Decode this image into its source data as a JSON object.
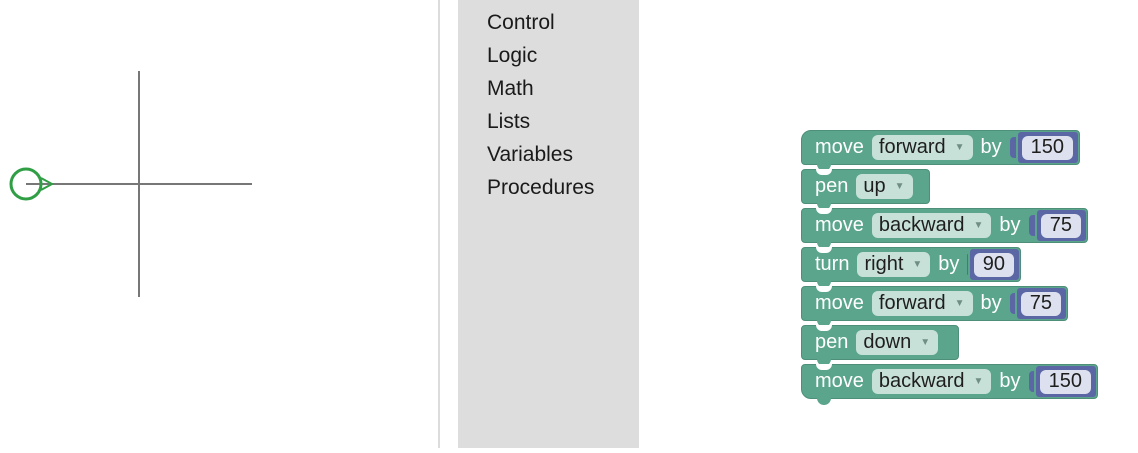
{
  "toolbox": {
    "categories": [
      "Control",
      "Logic",
      "Math",
      "Lists",
      "Variables",
      "Procedures"
    ]
  },
  "blocks": [
    {
      "keyword": "move",
      "dropdown": "forward",
      "connector": "by",
      "value": "150"
    },
    {
      "keyword": "pen",
      "dropdown": "up"
    },
    {
      "keyword": "move",
      "dropdown": "backward",
      "connector": "by",
      "value": "75"
    },
    {
      "keyword": "turn",
      "dropdown": "right",
      "connector": "by",
      "value": "90"
    },
    {
      "keyword": "move",
      "dropdown": "forward",
      "connector": "by",
      "value": "75"
    },
    {
      "keyword": "pen",
      "dropdown": "down"
    },
    {
      "keyword": "move",
      "dropdown": "backward",
      "connector": "by",
      "value": "150"
    }
  ],
  "colors": {
    "motion_block": "#5ba58c",
    "number_block": "#5b67a5",
    "turtle": "#2f9e44",
    "drawn_line": "#777777",
    "toolbox_bg": "#dddddd"
  },
  "icons": {
    "turtle": "turtle-icon"
  }
}
